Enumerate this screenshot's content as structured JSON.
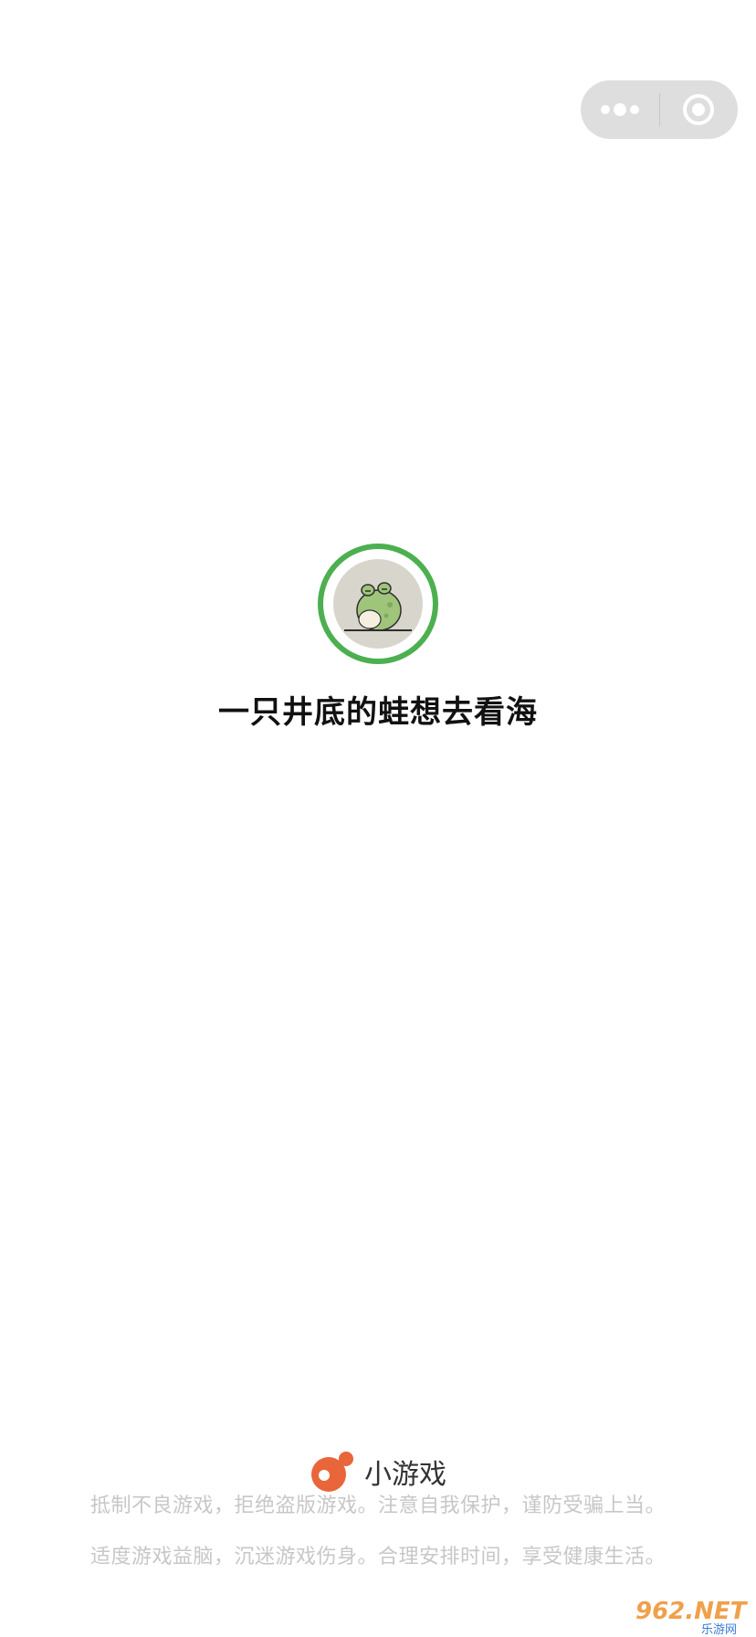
{
  "capsule": {
    "more_icon": "more-dots-icon",
    "close_icon": "target-close-icon"
  },
  "game": {
    "title": "一只井底的蛙想去看海",
    "avatar_icon": "frog-avatar"
  },
  "footer": {
    "brand_icon": "mini-game-logo-icon",
    "brand_label": "小游戏",
    "notice_line1": "抵制不良游戏，拒绝盗版游戏。注意自我保护，谨防受骗上当。",
    "notice_line2": "适度游戏益脑，沉迷游戏伤身。合理安排时间，享受健康生活。"
  },
  "watermark": {
    "text_main": "962.NET",
    "text_sub": "乐游网"
  },
  "colors": {
    "ring": "#4caf50",
    "brand_orange": "#e8663a",
    "capsule_bg": "#dedede"
  }
}
